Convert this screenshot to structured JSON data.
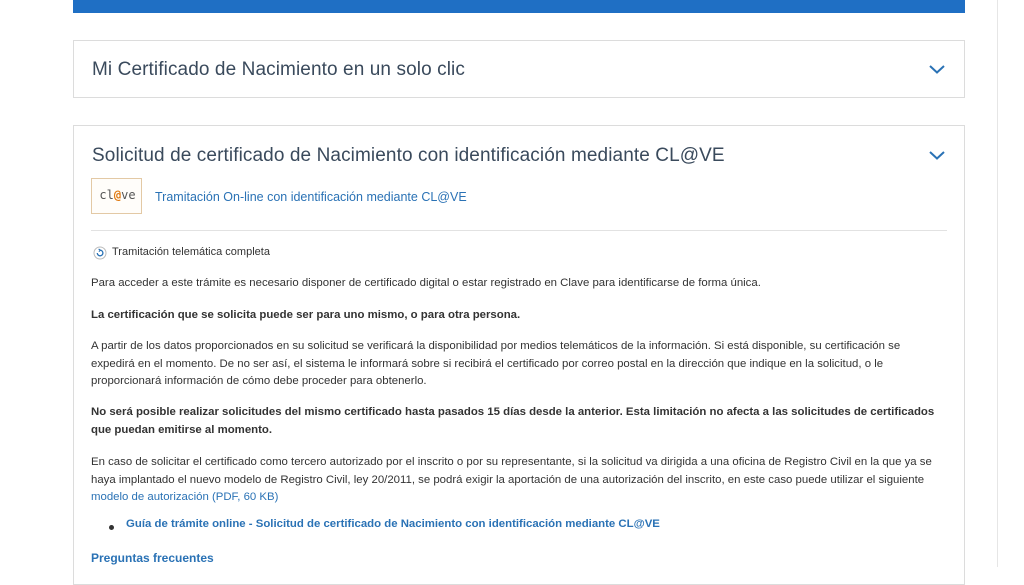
{
  "colors": {
    "accent_bar": "#1f6fc4",
    "link": "#2a72b5",
    "title_text": "#3a4a5c",
    "clave_orange": "#e07a12"
  },
  "panel1": {
    "title": "Mi Certificado de Nacimiento en un solo clic",
    "toggle_icon": "chevron-down-icon"
  },
  "panel2": {
    "title": "Solicitud de certificado de Nacimiento con identificación mediante CL@VE",
    "toggle_icon": "chevron-down-icon",
    "logo": {
      "prefix": "cl",
      "at": "@",
      "suffix": "ve"
    },
    "online_link": "Tramitación On-line con identificación mediante CL@VE",
    "processing_badge": {
      "icon": "refresh-icon",
      "label": "Tramitación telemática completa"
    },
    "paragraph1": "Para acceder a este trámite es necesario disponer de certificado digital o estar registrado en Clave para identificarse de forma única.",
    "paragraph2": "La certificación que se solicita puede ser para uno mismo, o para otra persona.",
    "paragraph3": "A partir de los datos proporcionados en su solicitud se verificará la disponibilidad por medios telemáticos de la información. Si está disponible, su certificación se expedirá en el momento. De no ser así, el sistema le informará sobre si recibirá el certificado por correo postal en la dirección que indique en la solicitud, o le proporcionará información de cómo debe proceder para obtenerlo.",
    "paragraph4": "No será posible realizar solicitudes del mismo certificado hasta pasados 15 días desde la anterior. Esta limitación no afecta a las solicitudes de certificados que puedan emitirse al momento.",
    "paragraph5_text": "En caso de solicitar el certificado como tercero autorizado por el inscrito o por su representante, si la solicitud va dirigida a una oficina de Registro Civil en la que ya se haya implantado el nuevo modelo de Registro Civil, ley 20/2011, se podrá exigir la aportación de una autorización del inscrito, en este caso puede utilizar el siguiente ",
    "paragraph5_link": "modelo de autorización (PDF, 60 KB)",
    "guide_link": "Guía de trámite online - Solicitud de certificado de Nacimiento con identificación mediante CL@VE",
    "faq_link": "Preguntas frecuentes"
  }
}
